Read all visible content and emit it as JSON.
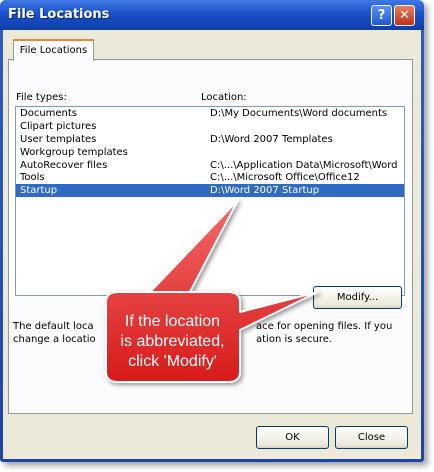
{
  "window": {
    "title": "File Locations"
  },
  "titlebar": {
    "help_glyph": "?",
    "close_glyph": "✕"
  },
  "tab": {
    "label": "File Locations"
  },
  "labels": {
    "file_types": "File types:",
    "location": "Location:"
  },
  "list": {
    "rows": [
      {
        "type": "Documents",
        "location": "D:\\My Documents\\Word documents"
      },
      {
        "type": "Clipart pictures",
        "location": ""
      },
      {
        "type": "User templates",
        "location": "D:\\Word 2007 Templates"
      },
      {
        "type": "Workgroup templates",
        "location": ""
      },
      {
        "type": "AutoRecover files",
        "location": "C:\\...\\Application Data\\Microsoft\\Word"
      },
      {
        "type": "Tools",
        "location": "C:\\...\\Microsoft Office\\Office12"
      },
      {
        "type": "Startup",
        "location": "D:\\Word 2007 Startup"
      }
    ],
    "selected_index": 6
  },
  "buttons": {
    "modify": "Modify...",
    "ok": "OK",
    "close": "Close"
  },
  "info_text": {
    "line1_left": "The default loca",
    "line1_right": "ace for opening files. If you",
    "line2_left": "change a locatio",
    "line2_right": "ation is secure."
  },
  "callout": {
    "lines": [
      "If the location",
      "is abbreviated,",
      "click 'Modify'"
    ],
    "fill": "#e82a2a"
  },
  "colors": {
    "selection": "#316ac5",
    "face": "#ece9d8",
    "titlebar": "#1a50c9"
  }
}
